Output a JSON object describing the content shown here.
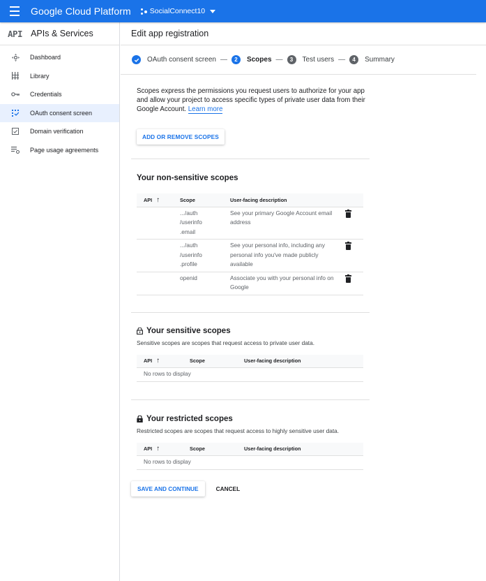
{
  "topbar": {
    "brand": "Google Cloud Platform",
    "project": "SocialConnect10",
    "color": "#1a73e8"
  },
  "sidebar": {
    "logo": "API",
    "title": "APIs & Services",
    "items": [
      {
        "label": "Dashboard",
        "icon": "dashboard-icon",
        "active": false
      },
      {
        "label": "Library",
        "icon": "library-icon",
        "active": false
      },
      {
        "label": "Credentials",
        "icon": "key-icon",
        "active": false
      },
      {
        "label": "OAuth consent screen",
        "icon": "consent-icon",
        "active": true
      },
      {
        "label": "Domain verification",
        "icon": "domain-check-icon",
        "active": false
      },
      {
        "label": "Page usage agreements",
        "icon": "settings-list-icon",
        "active": false
      }
    ]
  },
  "page": {
    "title": "Edit app registration"
  },
  "stepper": {
    "steps": [
      {
        "number": "✓",
        "label": "OAuth consent screen",
        "state": "done"
      },
      {
        "number": "2",
        "label": "Scopes",
        "state": "active"
      },
      {
        "number": "3",
        "label": "Test users",
        "state": "todo"
      },
      {
        "number": "4",
        "label": "Summary",
        "state": "todo"
      }
    ],
    "separator": "—"
  },
  "intro": {
    "text": "Scopes express the permissions you request users to authorize for your app and allow your project to access specific types of private user data from their Google Account. ",
    "link": "Learn more",
    "button": "ADD OR REMOVE SCOPES"
  },
  "columns": {
    "api": "API",
    "scope": "Scope",
    "description": "User-facing description"
  },
  "non_sensitive": {
    "title": "Your non-sensitive scopes",
    "rows": [
      {
        "api": "",
        "scope": [
          ".../auth",
          "/userinfo",
          ".email"
        ],
        "description": "See your primary Google Account email address"
      },
      {
        "api": "",
        "scope": [
          ".../auth",
          "/userinfo",
          ".profile"
        ],
        "description": "See your personal info, including any personal info you've made publicly available"
      },
      {
        "api": "",
        "scope": [
          "openid"
        ],
        "description": "Associate you with your personal info on Google"
      }
    ]
  },
  "sensitive": {
    "title": "Your sensitive scopes",
    "description": "Sensitive scopes are scopes that request access to private user data.",
    "empty": "No rows to display"
  },
  "restricted": {
    "title": "Your restricted scopes",
    "description": "Restricted scopes are scopes that request access to highly sensitive user data.",
    "empty": "No rows to display"
  },
  "actions": {
    "save": "SAVE AND CONTINUE",
    "cancel": "CANCEL"
  }
}
